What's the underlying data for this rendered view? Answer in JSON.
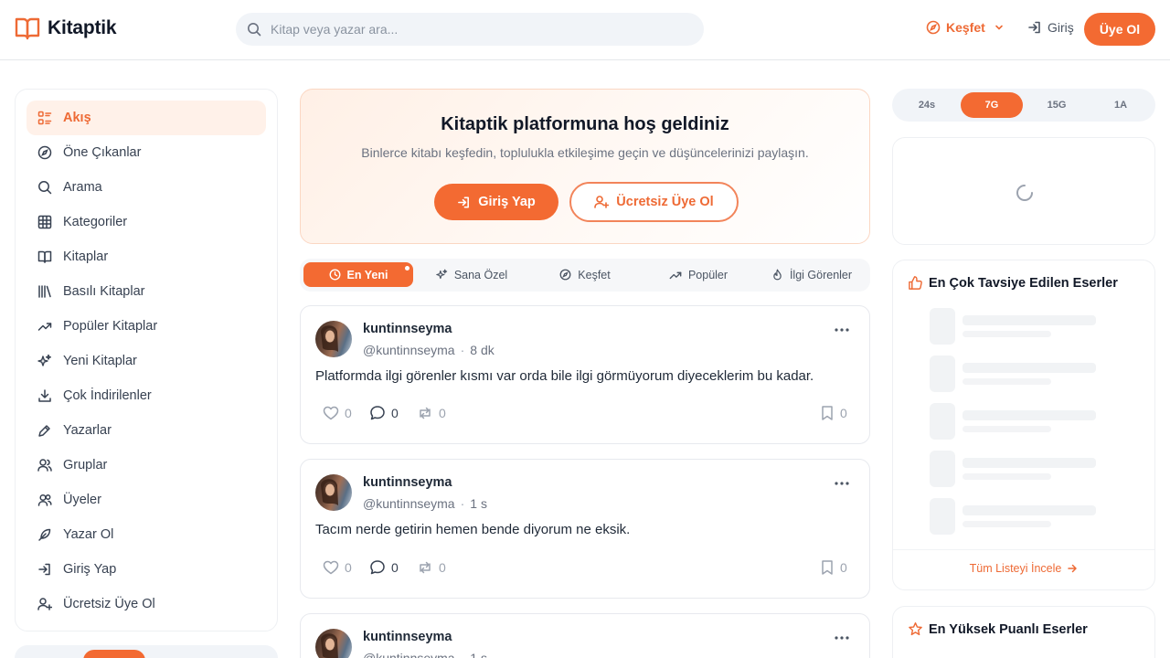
{
  "app": {
    "name": "Kitaptik"
  },
  "search": {
    "placeholder": "Kitap veya yazar ara..."
  },
  "header": {
    "explore_label": "Keşfet",
    "login_label": "Giriş",
    "signup_label": "Üye Ol"
  },
  "sidebar": {
    "items": [
      {
        "label": "Akış",
        "icon": "feed-icon",
        "active": true
      },
      {
        "label": "Öne Çıkanlar",
        "icon": "compass-icon"
      },
      {
        "label": "Arama",
        "icon": "search-icon"
      },
      {
        "label": "Kategoriler",
        "icon": "grid-icon"
      },
      {
        "label": "Kitaplar",
        "icon": "book-open-icon"
      },
      {
        "label": "Basılı Kitaplar",
        "icon": "library-icon"
      },
      {
        "label": "Popüler Kitaplar",
        "icon": "trending-icon"
      },
      {
        "label": "Yeni Kitaplar",
        "icon": "sparkles-icon"
      },
      {
        "label": "Çok İndirilenler",
        "icon": "download-icon"
      },
      {
        "label": "Yazarlar",
        "icon": "pen-icon"
      },
      {
        "label": "Gruplar",
        "icon": "group-icon"
      },
      {
        "label": "Üyeler",
        "icon": "users-icon"
      },
      {
        "label": "Yazar Ol",
        "icon": "feather-icon"
      },
      {
        "label": "Giriş Yap",
        "icon": "login-icon"
      },
      {
        "label": "Ücretsiz Üye Ol",
        "icon": "user-plus-icon"
      }
    ]
  },
  "welcome": {
    "title": "Kitaptik platformuna hoş geldiniz",
    "subtitle": "Binlerce kitabı keşfedin, toplulukla etkileşime geçin ve düşüncelerinizi paylaşın.",
    "login_label": "Giriş Yap",
    "signup_label": "Ücretsiz Üye Ol"
  },
  "feed_tabs": [
    {
      "label": "En Yeni",
      "active": true
    },
    {
      "label": "Sana Özel"
    },
    {
      "label": "Keşfet"
    },
    {
      "label": "Popüler"
    },
    {
      "label": "İlgi Görenler"
    }
  ],
  "posts": [
    {
      "name": "kuntinnseyma",
      "handle": "@kuntinnseyma",
      "time": "8 dk",
      "text": "Platformda ilgi görenler kısmı var orda bile ilgi görmüyorum diyeceklerim bu kadar.",
      "likes": "0",
      "comments": "0",
      "reposts": "0",
      "saves": "0"
    },
    {
      "name": "kuntinnseyma",
      "handle": "@kuntinnseyma",
      "time": "1 s",
      "text": "Tacım nerde getirin hemen bende diyorum ne eksik.",
      "likes": "0",
      "comments": "0",
      "reposts": "0",
      "saves": "0"
    },
    {
      "name": "kuntinnseyma",
      "handle": "@kuntinnseyma",
      "time": "1 s"
    }
  ],
  "time_ranges": [
    {
      "label": "24s"
    },
    {
      "label": "7G",
      "active": true
    },
    {
      "label": "15G"
    },
    {
      "label": "1A"
    }
  ],
  "recommended": {
    "title": "En Çok Tavsiye Edilen Eserler",
    "link": "Tüm Listeyi İncele"
  },
  "top_rated": {
    "title": "En Yüksek Puanlı Eserler"
  },
  "colors": {
    "accent": "#f36a32",
    "accent_text": "#ee6a35",
    "text": "#1f2937",
    "muted": "#6b7280"
  }
}
